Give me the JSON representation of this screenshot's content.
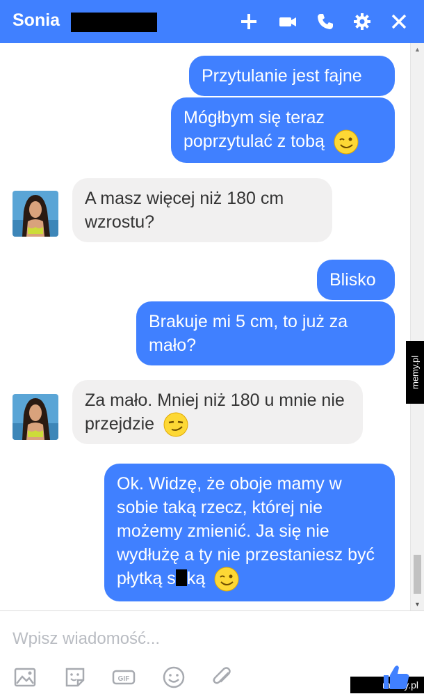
{
  "header": {
    "contact_name": "Sonia",
    "icons": [
      "plus-icon",
      "video-camera-icon",
      "phone-icon",
      "gear-icon",
      "close-icon"
    ],
    "color": "#4080ff"
  },
  "messages": [
    {
      "direction": "out",
      "text": "Przytulanie jest fajne"
    },
    {
      "direction": "out",
      "text": "Mógłbym się teraz poprzytulać z tobą",
      "emoji": "wink-emoji"
    },
    {
      "direction": "in",
      "text": "A masz więcej niż 180 cm wzrostu?"
    },
    {
      "direction": "out",
      "text": "Blisko"
    },
    {
      "direction": "out",
      "text": "Brakuje mi 5 cm, to już za mało?"
    },
    {
      "direction": "in",
      "text": "Za mało. Mniej niż 180 u mnie nie przejdzie",
      "emoji": "smirk-emoji"
    },
    {
      "direction": "out",
      "text": "Ok. Widzę, że oboje mamy w sobie taką rzecz, której nie możemy zmienić. Ja się nie wydłużę a ty nie przestaniesz być płytką s",
      "text_end": "ką",
      "emoji": "wink-emoji"
    }
  ],
  "composer": {
    "placeholder": "Wpisz wiadomość...",
    "tools": [
      "image-icon",
      "sticker-icon",
      "gif-icon",
      "emoji-icon",
      "paperclip-icon",
      "thumbs-up-icon"
    ]
  },
  "watermarks": {
    "side": "memy.pl",
    "corner": "memy.pl"
  },
  "colors": {
    "outgoing_bubble": "#4080ff",
    "incoming_bubble": "#f1f0f0"
  }
}
